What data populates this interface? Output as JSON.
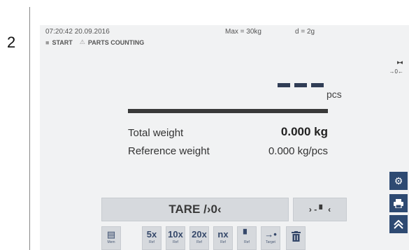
{
  "step_number": "2",
  "status": {
    "datetime": "07:20:42 20.09.2016",
    "max": "Max = 30kg",
    "d": "d = 2g"
  },
  "breadcrumb": {
    "start_icon": "stop-icon",
    "start": "START",
    "counting_icon": "warning-triangle-icon",
    "counting": "PARTS COUNTING"
  },
  "indicators": {
    "stability": "▸◂",
    "zero": "→0←"
  },
  "display": {
    "count_unit": "pcs"
  },
  "readings": {
    "total_label": "Total weight",
    "total_value": "0.000 kg",
    "ref_label": "Reference weight",
    "ref_value": "0.000 kg/pcs"
  },
  "buttons": {
    "tare": "TARE /›0‹",
    "zero": "› - ▘ ‹"
  },
  "keys": [
    {
      "main": "▤",
      "sub": "Mem"
    },
    {
      "main": "5x",
      "sub": "Ref"
    },
    {
      "main": "10x",
      "sub": "Ref"
    },
    {
      "main": "20x",
      "sub": "Ref"
    },
    {
      "main": "nx",
      "sub": "Ref"
    },
    {
      "main": "▘",
      "sub": "Ref"
    },
    {
      "main": "→•",
      "sub": "Target"
    },
    {
      "main": "🗑",
      "sub": ""
    }
  ],
  "side_buttons": {
    "settings_icon": "gear-icon",
    "print_icon": "printer-icon",
    "home_icon": "home-icon"
  },
  "colors": {
    "accent": "#2e4a72",
    "screen_bg": "#f1f2f3",
    "button_bg": "#d6d9dd"
  }
}
